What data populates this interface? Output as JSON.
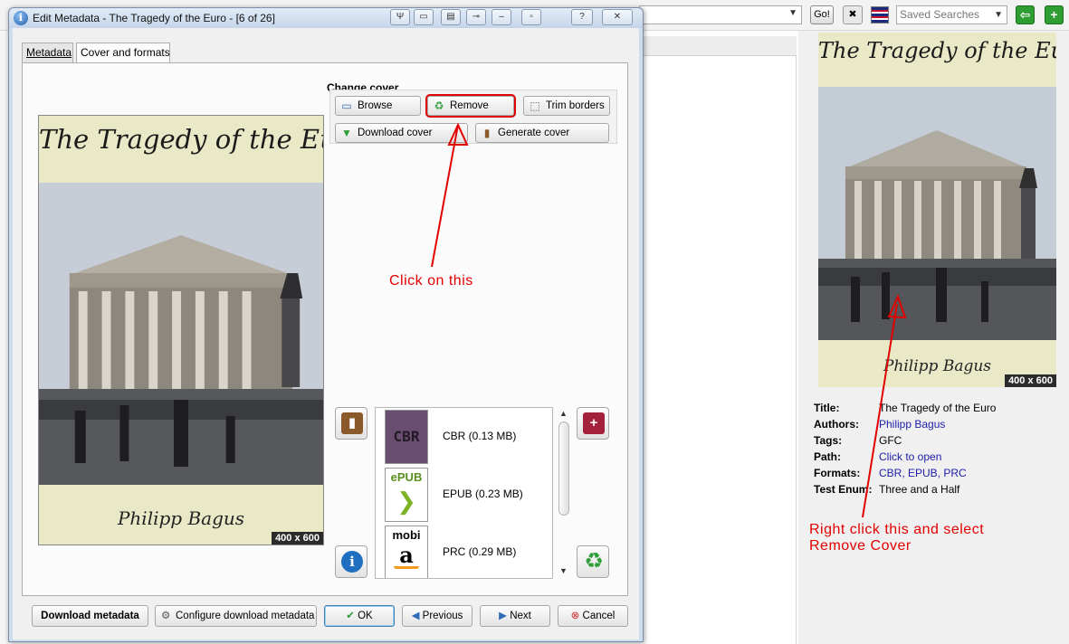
{
  "background": {
    "go_label": "Go!",
    "saved_searches_placeholder": "Saved Searches"
  },
  "dialog": {
    "title": "Edit Metadata - The Tragedy of the Euro -  [6 of 26]",
    "title_buttons": [
      "?",
      "✕"
    ],
    "tabs": [
      {
        "label": "Metadata",
        "active": false
      },
      {
        "label": "Cover and formats",
        "active": true
      }
    ],
    "change_cover": {
      "heading": "Change cover",
      "browse_label": "Browse",
      "remove_label": "Remove",
      "trim_label": "Trim borders",
      "download_cover_label": "Download cover",
      "generate_cover_label": "Generate cover"
    },
    "cover_preview": {
      "title_text": "The Tragedy of the Euro",
      "author_text": "Philipp Bagus",
      "size_badge": "400 x 600"
    },
    "formats": [
      {
        "icon_text": "CBR",
        "label": "CBR (0.13 MB)"
      },
      {
        "icon_text": "ePUB",
        "label": "EPUB (0.23 MB)"
      },
      {
        "icon_text": "mobi",
        "label": "PRC (0.29 MB)"
      }
    ],
    "bottom_buttons": {
      "download_metadata": "Download metadata",
      "configure": "Configure download metadata",
      "ok": "OK",
      "previous": "Previous",
      "next": "Next",
      "cancel": "Cancel"
    }
  },
  "book_details": {
    "cover_title": "The Tragedy of the Euro",
    "cover_author": "Philipp Bagus",
    "size_badge": "400 x 600",
    "fields": [
      {
        "label": "Title:",
        "value": "The Tragedy of the Euro",
        "link": false
      },
      {
        "label": "Authors:",
        "value": "Philipp Bagus",
        "link": true
      },
      {
        "label": "Tags:",
        "value": "GFC",
        "link": false
      },
      {
        "label": "Path:",
        "value": "Click to open",
        "link": true
      },
      {
        "label": "Formats:",
        "value": "CBR, EPUB, PRC",
        "link": true
      },
      {
        "label": "Test Enum:",
        "value": "Three and a Half",
        "link": false
      }
    ]
  },
  "annotations": {
    "click_text": "Click on this",
    "right_click_line1": "Right click this and select",
    "right_click_line2": "Remove Cover",
    "color": "#e30000"
  }
}
